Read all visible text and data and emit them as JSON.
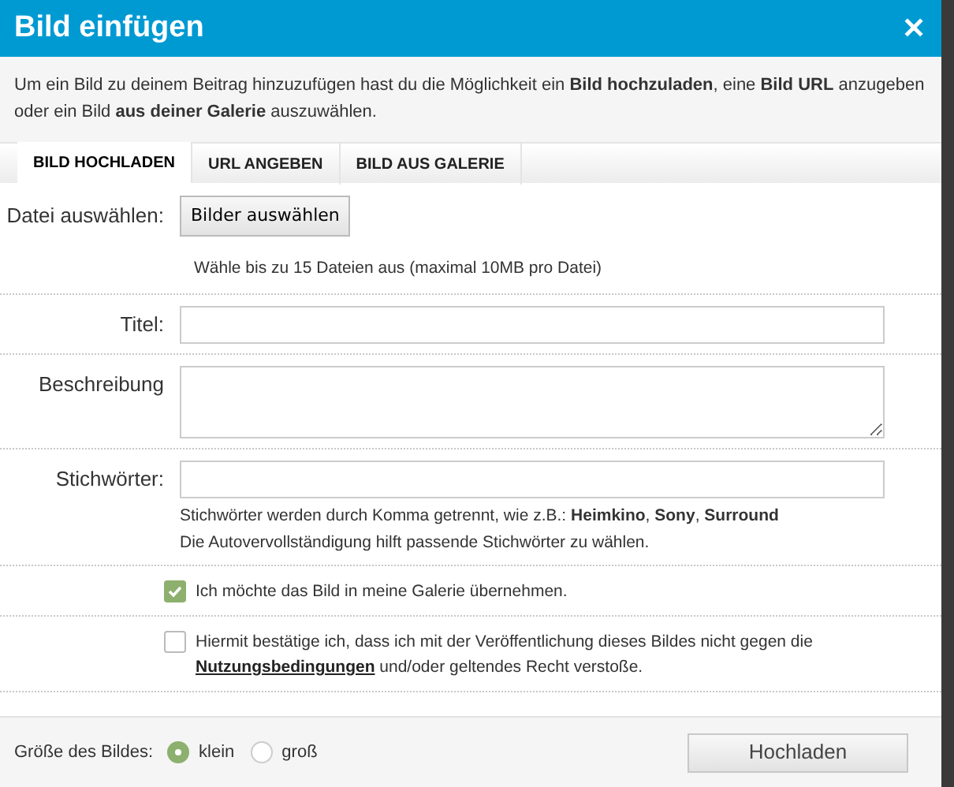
{
  "dialog": {
    "title": "Bild einfügen",
    "close_glyph": "✕"
  },
  "intro": "Um ein Bild zu deinem Beitrag hinzuzufügen hast du die Möglichkeit ein **Bild hochzuladen**, eine **Bild URL** anzugeben oder ein Bild **aus deiner Galerie** auszuwählen.",
  "tabs": [
    {
      "label": "BILD HOCHLADEN",
      "selected": true
    },
    {
      "label": "URL ANGEBEN",
      "selected": false
    },
    {
      "label": "BILD AUS GALERIE",
      "selected": false
    }
  ],
  "file_row": {
    "label": "Datei auswählen:",
    "button": "Bilder auswählen",
    "hint": "Wähle bis zu 15 Dateien aus (maximal 10MB pro Datei)"
  },
  "fields": [
    {
      "kind": "input",
      "label": "Titel:"
    },
    {
      "kind": "textarea",
      "label": "Beschreibung"
    },
    {
      "kind": "input",
      "label": "Stichwörter:",
      "hints": [
        "Stichwörter werden durch Komma getrennt, wie z.B.: **Heimkino**, **Sony**, **Surround**",
        "Die Autovervollständigung hilft passende Stichwörter zu wählen."
      ]
    }
  ],
  "checkboxes": [
    {
      "text_before": "Ich möchte das Bild in meine Galerie übernehmen.",
      "checked": true
    },
    {
      "text_before": "Hiermit bestätige ich, dass ich mit der Veröffentlichung dieses Bildes nicht gegen die",
      "link": "Nutzungsbedingungen",
      "text_after": "und/oder geltendes Recht verstoße.",
      "checked": false
    }
  ],
  "footer": {
    "size_label": "Größe des Bildes:",
    "sizes": [
      {
        "label": "klein",
        "selected": true
      },
      {
        "label": "groß",
        "selected": false
      }
    ],
    "submit": "Hochladen"
  }
}
